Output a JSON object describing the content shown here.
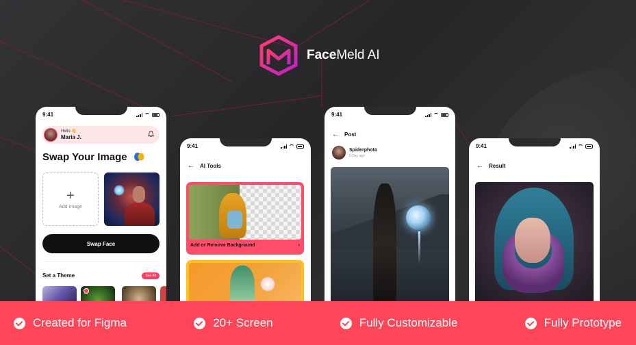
{
  "brand": {
    "name_bold": "Face",
    "name_rest": "Meld AI",
    "accent": "#ff4559",
    "logo_icon": "facemeld-logo-icon"
  },
  "status_time": "9:41",
  "screen_home": {
    "hello": "Hello 👋",
    "user_name": "Maria J.",
    "title": "Swap Your Image",
    "add_image_label": "Add Image",
    "swap_button": "Swap Face",
    "theme_title": "Set a Theme",
    "see_all": "See All"
  },
  "screen_tools": {
    "header": "AI Tools",
    "card1_label": "Add or Remove Background"
  },
  "screen_post": {
    "header": "Post",
    "user": "Spiderphoto",
    "time": "5 Day ago"
  },
  "screen_result": {
    "header": "Result"
  },
  "features": [
    {
      "label": "Created for Figma"
    },
    {
      "label": "20+ Screen"
    },
    {
      "label": "Fully Customizable"
    },
    {
      "label": "Fully Prototype"
    }
  ]
}
